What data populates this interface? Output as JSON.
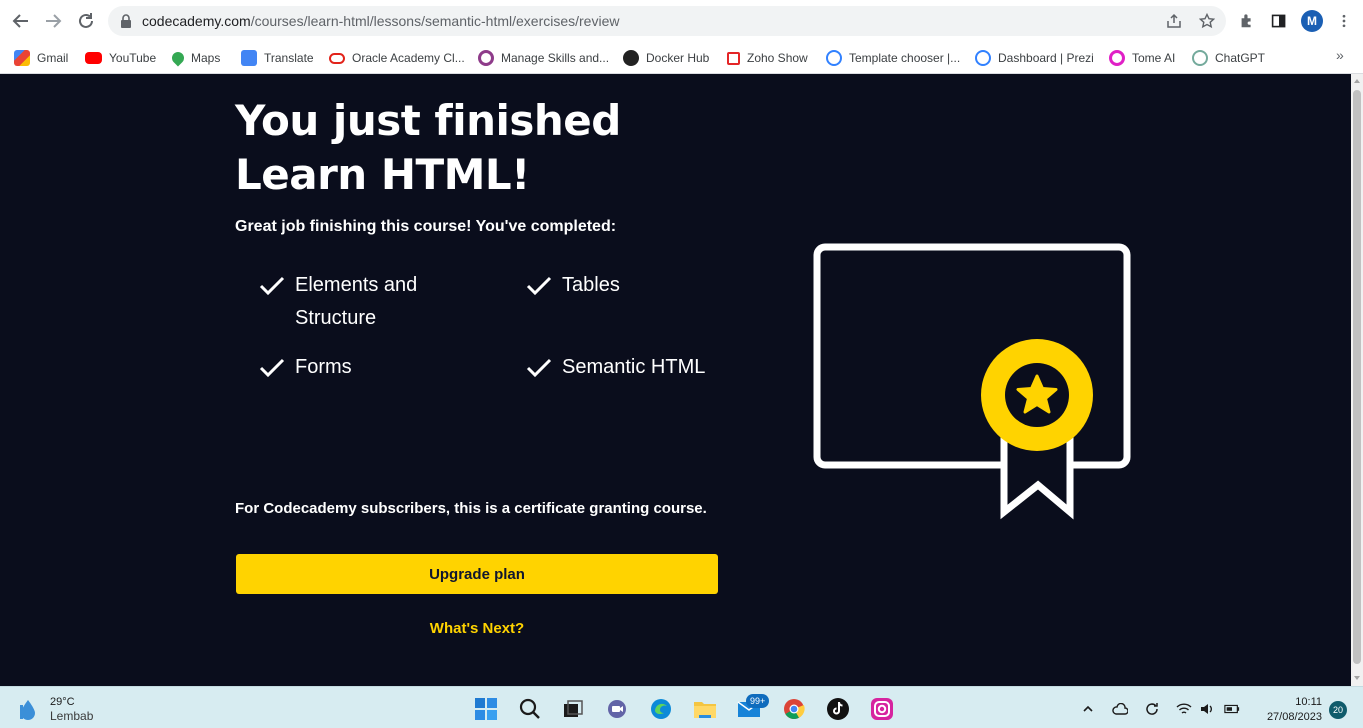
{
  "browser": {
    "url_host": "codecademy.com",
    "url_path": "/courses/learn-html/lessons/semantic-html/exercises/review",
    "profile_initial": "M",
    "bookmarks": [
      {
        "label": "Gmail",
        "icon": "gmail-icon",
        "color": "#ea4335"
      },
      {
        "label": "YouTube",
        "icon": "youtube-icon",
        "color": "#ff0000"
      },
      {
        "label": "Maps",
        "icon": "maps-icon",
        "color": "#34a853"
      },
      {
        "label": "Translate",
        "icon": "translate-icon",
        "color": "#4285f4"
      },
      {
        "label": "Oracle Academy Cl...",
        "icon": "oracle-icon",
        "color": "#e2231a"
      },
      {
        "label": "Manage Skills and...",
        "icon": "skills-icon",
        "color": "#8e3b8a"
      },
      {
        "label": "Docker Hub",
        "icon": "docker-icon",
        "color": "#222222"
      },
      {
        "label": "Zoho Show",
        "icon": "zoho-icon",
        "color": "#e42527"
      },
      {
        "label": "Template chooser |...",
        "icon": "prezi-icon",
        "color": "#3181ff"
      },
      {
        "label": "Dashboard | Prezi",
        "icon": "prezi-icon",
        "color": "#3181ff"
      },
      {
        "label": "Tome AI",
        "icon": "tome-icon",
        "color": "#e020c6"
      },
      {
        "label": "ChatGPT",
        "icon": "chatgpt-icon",
        "color": "#74aa9c"
      }
    ],
    "more_bookmarks": "»"
  },
  "page": {
    "headline_line1": "You just finished",
    "headline_line2": "Learn HTML!",
    "intro": "Great job finishing this course! You've completed:",
    "lessons": [
      {
        "line1": "Elements and",
        "line2": "Structure"
      },
      {
        "line1": "Tables",
        "line2": ""
      },
      {
        "line1": "Forms",
        "line2": ""
      },
      {
        "line1": "Semantic HTML",
        "line2": ""
      }
    ],
    "subscriber_note": "For Codecademy subscribers, this is a certificate granting course.",
    "upgrade_label": "Upgrade plan",
    "whats_next_label": "What's Next?",
    "colors": {
      "background": "#0a0d1c",
      "accent": "#ffd300",
      "text": "#ffffff"
    }
  },
  "taskbar": {
    "weather_temp": "29°C",
    "weather_place": "Lembab",
    "mail_badge": "99+",
    "time": "10:11",
    "date": "27/08/2023",
    "notifications": "20"
  }
}
